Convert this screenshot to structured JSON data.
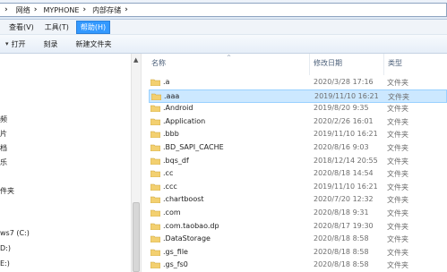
{
  "breadcrumb": [
    "网络",
    "MYPHONE",
    "内部存储"
  ],
  "menu": {
    "view": "查看(V)",
    "tools": "工具(T)",
    "help": "帮助(H)"
  },
  "toolbar": {
    "open": "打开",
    "burn": "刻录",
    "new_folder": "新建文件夹"
  },
  "nav": {
    "items": [
      "频",
      "片",
      "档",
      "乐",
      "件夹",
      "ws7 (C:)",
      "D:)",
      "E:)"
    ]
  },
  "columns": {
    "name": "名称",
    "date": "修改日期",
    "type": "类型"
  },
  "files": [
    {
      "name": ".a",
      "date": "2020/3/28 17:16",
      "type": "文件夹"
    },
    {
      "name": ".aaa",
      "date": "2019/11/10 16:21",
      "type": "文件夹",
      "selected": true
    },
    {
      "name": ".Android",
      "date": "2019/8/20 9:35",
      "type": "文件夹"
    },
    {
      "name": ".Application",
      "date": "2020/2/26 16:01",
      "type": "文件夹"
    },
    {
      "name": ".bbb",
      "date": "2019/11/10 16:21",
      "type": "文件夹"
    },
    {
      "name": ".BD_SAPI_CACHE",
      "date": "2020/8/16 9:03",
      "type": "文件夹"
    },
    {
      "name": ".bqs_df",
      "date": "2018/12/14 20:55",
      "type": "文件夹"
    },
    {
      "name": ".cc",
      "date": "2020/8/18 14:54",
      "type": "文件夹"
    },
    {
      "name": ".ccc",
      "date": "2019/11/10 16:21",
      "type": "文件夹"
    },
    {
      "name": ".chartboost",
      "date": "2020/7/20 12:32",
      "type": "文件夹"
    },
    {
      "name": ".com",
      "date": "2020/8/18 9:31",
      "type": "文件夹"
    },
    {
      "name": ".com.taobao.dp",
      "date": "2020/8/17 19:30",
      "type": "文件夹"
    },
    {
      "name": ".DataStorage",
      "date": "2020/8/18 8:58",
      "type": "文件夹"
    },
    {
      "name": ".gs_file",
      "date": "2020/8/18 8:58",
      "type": "文件夹"
    },
    {
      "name": ".gs_fs0",
      "date": "2020/8/18 8:58",
      "type": "文件夹"
    }
  ],
  "colors": {
    "selection": "#cce8ff",
    "menu_active": "#3399ff",
    "folder": "#f3d070"
  }
}
